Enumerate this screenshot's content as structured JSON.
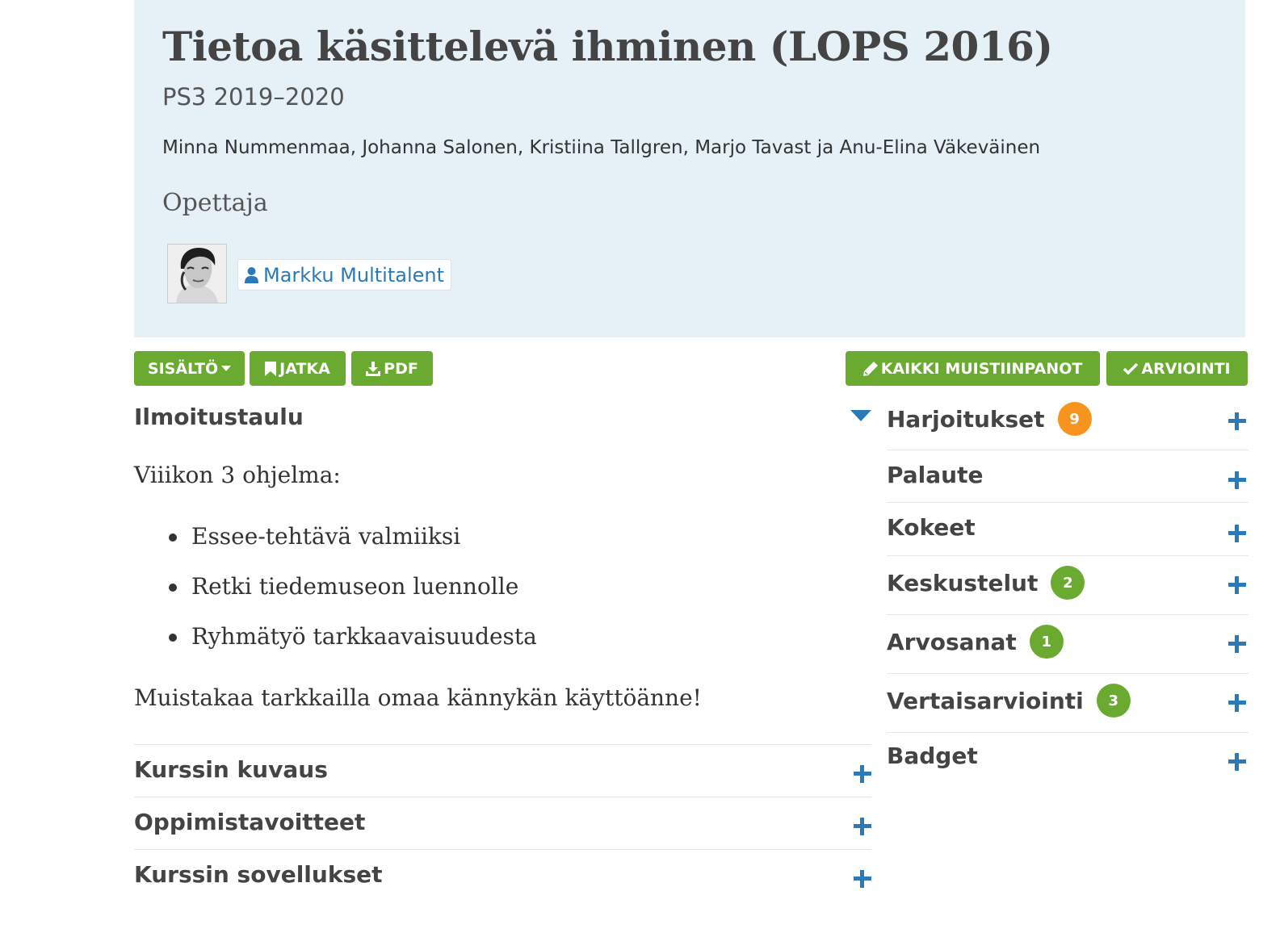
{
  "course": {
    "title": "Tietoa käsittelevä ihminen (LOPS 2016)",
    "code": "PS3 2019–2020",
    "authors": "Minna Nummenmaa, Johanna Salonen, Kristiina Tallgren, Marjo Tavast ja Anu-Elina Väkeväinen"
  },
  "teacher": {
    "heading": "Opettaja",
    "name": "Markku Multitalent",
    "icon": "user-icon",
    "avatar": "teacher-photo"
  },
  "toolbar": {
    "content_label": "SISÄLTÖ",
    "continue_label": "JATKA",
    "pdf_label": "PDF",
    "notes_label": "KAIKKI MUISTIINPANOT",
    "grading_label": "ARVIOINTI"
  },
  "notice": {
    "title": "Ilmoitustaulu",
    "intro": "Viiikon 3 ohjelma:",
    "items": [
      "Essee-tehtävä valmiiksi",
      "Retki tiedemuseon luennolle",
      "Ryhmätyö tarkkaavaisuudesta"
    ],
    "outro": "Muistakaa tarkkailla omaa kännykän käyttöänne!"
  },
  "left_sections": [
    {
      "label": "Kurssin kuvaus"
    },
    {
      "label": "Oppimistavoitteet"
    },
    {
      "label": "Kurssin sovellukset"
    }
  ],
  "right_sections": [
    {
      "label": "Harjoitukset",
      "badge": "9",
      "badge_color": "#f7941d"
    },
    {
      "label": "Palaute"
    },
    {
      "label": "Kokeet"
    },
    {
      "label": "Keskustelut",
      "badge": "2",
      "badge_color": "#6aaa30"
    },
    {
      "label": "Arvosanat",
      "badge": "1",
      "badge_color": "#6aaa30"
    },
    {
      "label": "Vertaisarviointi",
      "badge": "3",
      "badge_color": "#6aaa30"
    },
    {
      "label": "Badget"
    }
  ],
  "colors": {
    "header_bg": "#e5f0f7",
    "button_green": "#6aaa30",
    "link_blue": "#2a7ab8",
    "badge_orange": "#f7941d"
  }
}
